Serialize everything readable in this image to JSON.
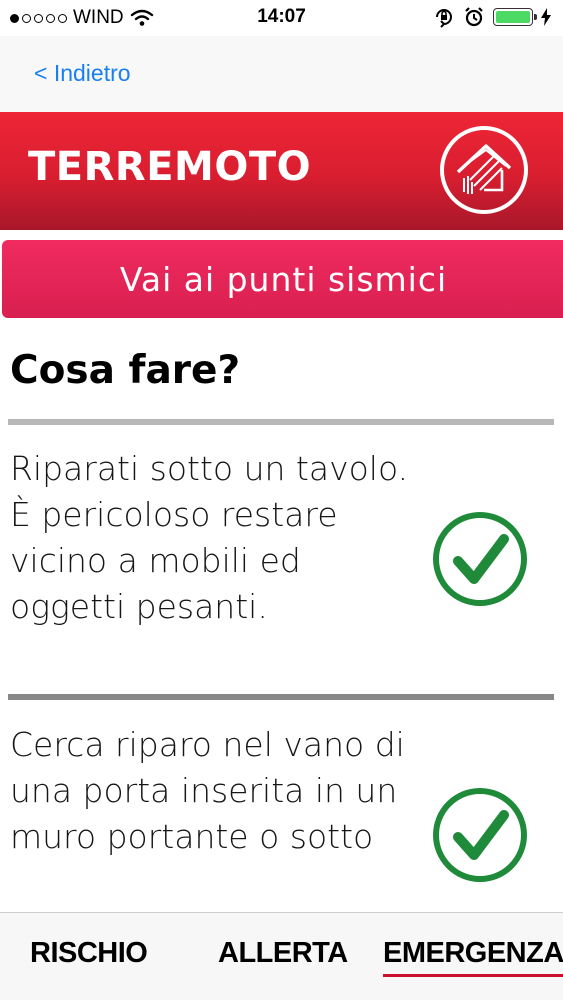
{
  "status_bar": {
    "carrier": "WIND",
    "time": "14:07",
    "signal_bars_filled": 1,
    "signal_bars_total": 5,
    "battery_color": "#4cd964"
  },
  "nav": {
    "back_label": "< Indietro"
  },
  "header": {
    "title": "TERREMOTO",
    "gradient_colors": [
      "#ee2536",
      "#a8172a"
    ]
  },
  "cta": {
    "label": "Vai ai punti sismici",
    "color": "#e42558"
  },
  "section": {
    "title": "Cosa fare?"
  },
  "advice_items": [
    {
      "text": "Riparati sotto un tavolo. È pericoloso restare vicino a mobili ed oggetti pesanti.",
      "icon": "checkmark-icon"
    },
    {
      "text": "Cerca riparo nel vano di una porta inserita in un muro portante o sotto",
      "icon": "checkmark-icon"
    }
  ],
  "check_color": "#1f8a3a",
  "tabs": [
    {
      "label": "RISCHIO",
      "active": false
    },
    {
      "label": "ALLERTA",
      "active": false
    },
    {
      "label": "EMERGENZA",
      "active": true
    }
  ],
  "accent_color": "#c8102e"
}
